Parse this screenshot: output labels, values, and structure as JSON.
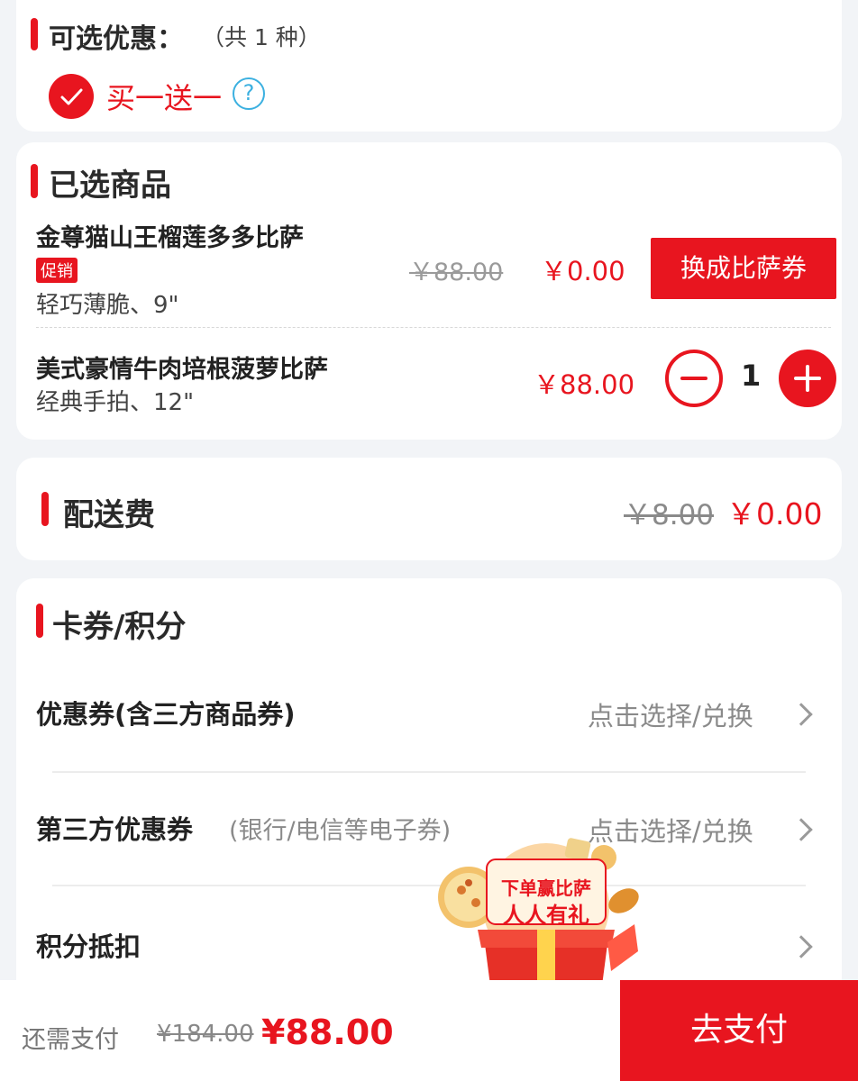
{
  "offers": {
    "title": "可选优惠：",
    "count_text": "（共 1 种）",
    "option_label": "买一送一",
    "help_glyph": "?"
  },
  "selected": {
    "title": "已选商品",
    "items": [
      {
        "name": "金尊猫山王榴莲多多比萨",
        "tag": "促销",
        "spec": "轻巧薄脆、9\"",
        "original_price": "￥88.00",
        "price": "￥0.00",
        "action_label": "换成比萨券"
      },
      {
        "name": "美式豪情牛肉培根菠萝比萨",
        "spec": "经典手拍、12\"",
        "price": "￥88.00",
        "quantity": "1"
      }
    ]
  },
  "delivery": {
    "title": "配送费",
    "original_price": "￥8.00",
    "price": "￥0.00"
  },
  "coupons": {
    "title": "卡券/积分",
    "rows": [
      {
        "label": "优惠券(含三方商品券)",
        "sublabel": "",
        "action": "点击选择/兑换"
      },
      {
        "label": "第三方优惠券",
        "sublabel": "(银行/电信等电子券)",
        "action": "点击选择/兑换"
      },
      {
        "label": "积分抵扣",
        "sublabel": "",
        "action": ""
      }
    ]
  },
  "promo_badge": {
    "line1": "下单赢比萨",
    "line2": "人人有礼"
  },
  "footer": {
    "label": "还需支付",
    "original_total": "¥184.00",
    "total": "¥88.00",
    "pay_button": "去支付"
  },
  "colors": {
    "accent": "#e8151f",
    "help": "#3bb0e0",
    "background": "#f2f4f7"
  }
}
